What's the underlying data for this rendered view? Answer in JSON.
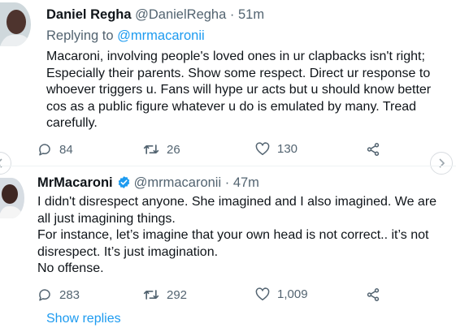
{
  "tweets": [
    {
      "display_name": "Daniel Regha",
      "handle": "@DanielRegha",
      "separator": "·",
      "time": "51m",
      "reply_prefix": "Replying to",
      "reply_handle": "@mrmacaronii",
      "lines": [
        "Macaroni, involving people's loved ones in ur clapbacks isn't right;",
        "Especially their parents. Show some respect. Direct ur response to",
        "whoever triggers u. Fans will hype ur acts but u should know better",
        "cos as a public figure whatever u do is emulated by many. Tread",
        "carefully."
      ],
      "replies": "84",
      "retweets": "26",
      "likes": "130"
    },
    {
      "display_name": "MrMacaroni",
      "handle": "@mrmacaronii",
      "separator": "·",
      "time": "47m",
      "verified": true,
      "lines": [
        "I didn't disrespect anyone. She imagined and I also imagined. We are",
        "all just imagining things.",
        "For instance, let’s imagine that your own head is not correct.. it’s not",
        "disrespect. It’s just imagination.",
        "No offense."
      ],
      "replies": "283",
      "retweets": "292",
      "likes": "1,009"
    }
  ],
  "show_replies_label": "Show replies",
  "colors": {
    "link": "#1d9bf0",
    "muted": "#536471",
    "text": "#0f1419"
  },
  "icons": [
    "comment-icon",
    "retweet-icon",
    "heart-icon",
    "share-icon",
    "verified-badge-icon",
    "chevron-left-icon",
    "chevron-right-icon"
  ]
}
